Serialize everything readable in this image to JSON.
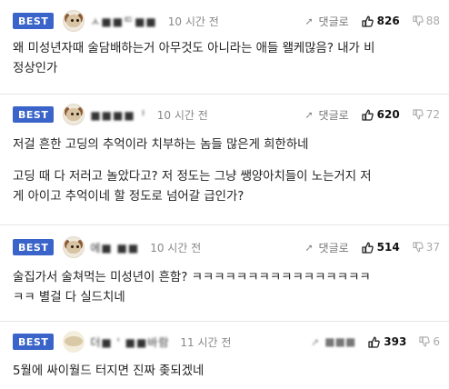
{
  "comments": [
    {
      "badge": "BEST",
      "nickname": "ㅅ■■ᄃ■■",
      "time": "10 시간 전",
      "reply_label": "댓글로",
      "likes": "826",
      "dislikes": "88",
      "avatar_icon": "puppy-avatar-icon",
      "paragraphs": [
        "왜 미성년자때 술담배하는거 아무것도 아니라는 애들 왤케많음? 내가 비\n정상인가"
      ]
    },
    {
      "badge": "BEST",
      "nickname": "■■■■ᅵ",
      "time": "10 시간 전",
      "reply_label": "댓글로",
      "likes": "620",
      "dislikes": "72",
      "avatar_icon": "puppy-avatar-icon",
      "paragraphs": [
        "저걸 흔한 고딩의 추억이라 치부하는 놈들 많은게 희한하네",
        "고딩 때 다 저러고 놀았다고? 저 정도는 그냥 쌩양아치들이 노는거지 저\n게 아이고 추억이네 할 정도로 넘어갈 급인가?"
      ]
    },
    {
      "badge": "BEST",
      "nickname": "에■ ■■",
      "time": "10 시간 전",
      "reply_label": "댓글로",
      "likes": "514",
      "dislikes": "37",
      "avatar_icon": "puppy-avatar-icon",
      "paragraphs": [
        "술집가서 술쳐먹는 미성년이 흔함? ㅋㅋㅋㅋㅋㅋㅋㅋㅋㅋㅋㅋㅋㅋㅋㅋ\nㅋㅋ 별걸 다 실드치네"
      ]
    },
    {
      "badge": "BEST",
      "nickname": "더■ ' ■■바람",
      "time": "11 시간 전",
      "reply_label": "■■■",
      "likes": "393",
      "dislikes": "6",
      "avatar_icon": "egg-avatar-icon",
      "paragraphs": [
        "5월에 싸이월드 터지면 진짜 좆되겠네"
      ]
    }
  ]
}
